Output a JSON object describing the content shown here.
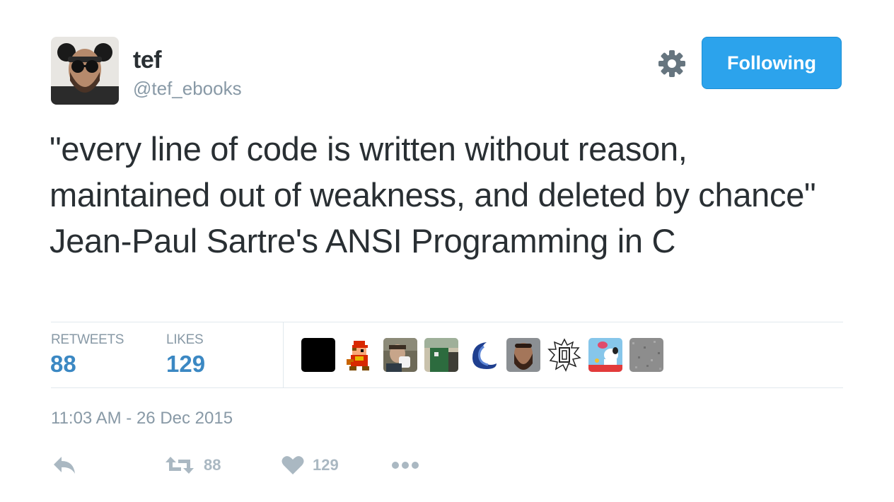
{
  "user": {
    "display_name": "tef",
    "handle": "@tef_ebooks",
    "avatar_icon": "avatar-man-mouse-ears"
  },
  "follow_button": {
    "label": "Following",
    "color": "#2ca3ec"
  },
  "settings_icon": "gear-icon",
  "tweet": {
    "text": "\"every line of code is written without reason, maintained out of weakness, and deleted by chance\" Jean-Paul Sartre's ANSI Programming in C"
  },
  "stats": {
    "retweets_label": "RETWEETS",
    "retweets_value": "88",
    "likes_label": "LIKES",
    "likes_value": "129"
  },
  "likers": [
    "black-square-avatar",
    "pixel-mario-avatar",
    "person-mug-avatar",
    "green-door-avatar",
    "blue-wave-avatar",
    "bearded-man-avatar",
    "sketch-box-avatar",
    "snoopy-doghouse-avatar",
    "grey-noise-avatar"
  ],
  "timestamp": "11:03 AM - 26 Dec 2015",
  "actions": {
    "reply_icon": "reply-icon",
    "retweet_icon": "retweet-icon",
    "retweet_count": "88",
    "like_icon": "heart-icon",
    "like_count": "129",
    "more_icon": "more-dots-icon"
  },
  "colors": {
    "text": "#292f33",
    "muted": "#8899a6",
    "stat_value": "#3b88c3",
    "action_icon": "#aab8c2",
    "divider": "#e1e8ed"
  }
}
